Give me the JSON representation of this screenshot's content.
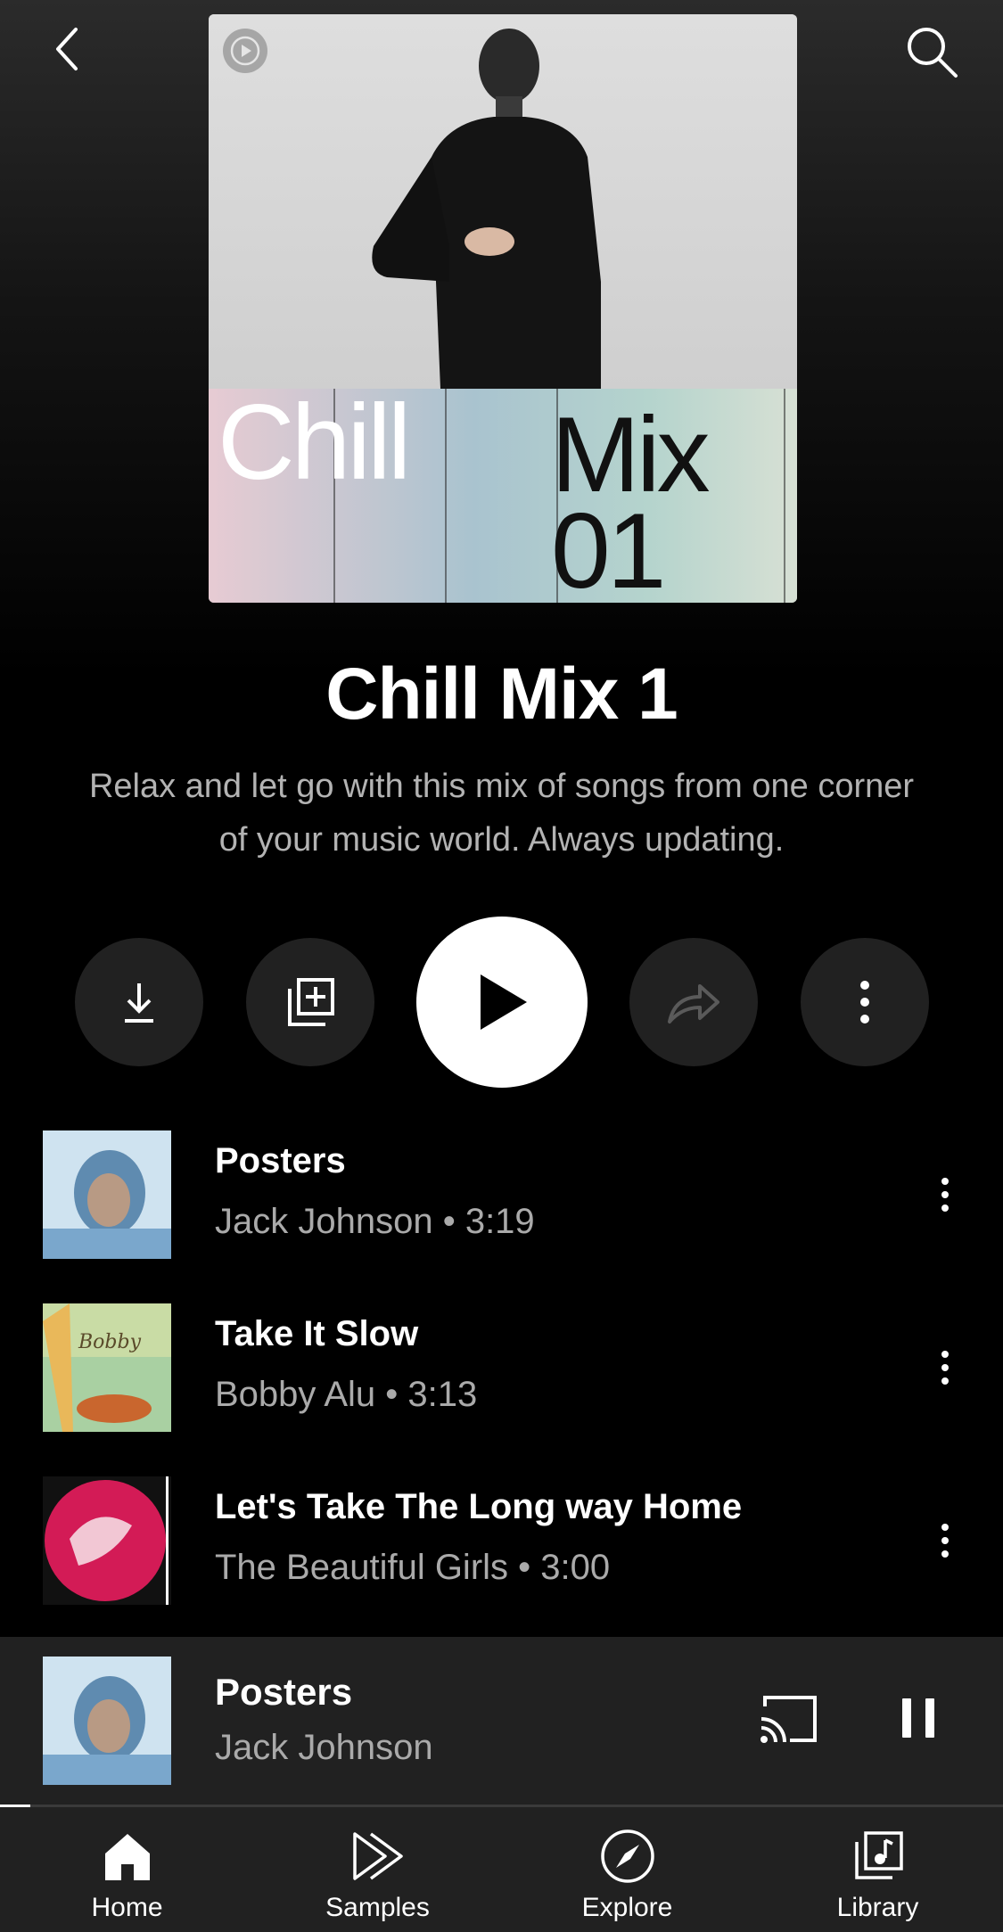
{
  "header": {
    "back_icon": "chevron-left-icon",
    "search_icon": "search-icon"
  },
  "cover": {
    "word1": "Chill",
    "word2": "Mix\n01"
  },
  "playlist": {
    "title": "Chill Mix 1",
    "description": "Relax and let go with this mix of songs from one corner of your music world. Always updating."
  },
  "actions": {
    "download_icon": "download-icon",
    "save_icon": "add-to-library-icon",
    "play_icon": "play-icon",
    "share_icon": "share-icon",
    "more_icon": "more-vertical-icon"
  },
  "tracks": [
    {
      "title": "Posters",
      "subtitle": "Jack Johnson • 3:19"
    },
    {
      "title": "Take It Slow",
      "subtitle": "Bobby Alu • 3:13"
    },
    {
      "title": "Let's Take The Long way Home",
      "subtitle": "The Beautiful Girls • 3:00"
    }
  ],
  "now_playing": {
    "title": "Posters",
    "artist": "Jack Johnson",
    "progress": 0.03,
    "cast_icon": "cast-icon",
    "pause_icon": "pause-icon"
  },
  "nav": [
    {
      "label": "Home",
      "icon": "home-icon"
    },
    {
      "label": "Samples",
      "icon": "samples-icon"
    },
    {
      "label": "Explore",
      "icon": "compass-icon"
    },
    {
      "label": "Library",
      "icon": "library-icon"
    }
  ]
}
